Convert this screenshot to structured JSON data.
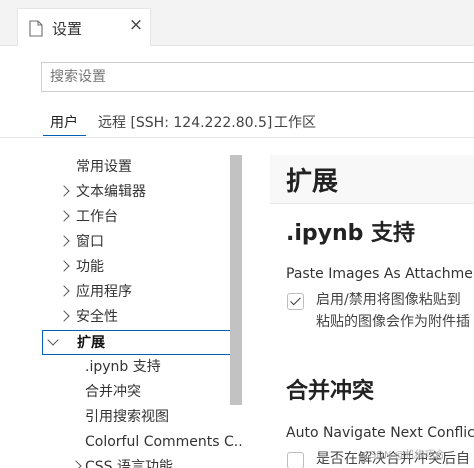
{
  "tab": {
    "title": "设置",
    "close_glyph": "×",
    "file_icon": "file-icon"
  },
  "search": {
    "placeholder": "搜索设置",
    "value": ""
  },
  "scopes": [
    {
      "label": "用户",
      "active": true
    },
    {
      "label": "远程 [SSH: 124.222.80.5]",
      "active": false
    },
    {
      "label": "工作区",
      "active": false
    }
  ],
  "tree": [
    {
      "label": "常用设置",
      "chevron": "none"
    },
    {
      "label": "文本编辑器",
      "chevron": "right"
    },
    {
      "label": "工作台",
      "chevron": "right"
    },
    {
      "label": "窗口",
      "chevron": "right"
    },
    {
      "label": "功能",
      "chevron": "right"
    },
    {
      "label": "应用程序",
      "chevron": "right"
    },
    {
      "label": "安全性",
      "chevron": "right"
    },
    {
      "label": "扩展",
      "chevron": "down",
      "selected": true
    },
    {
      "label": ".ipynb 支持",
      "child": true
    },
    {
      "label": "合并冲突",
      "child": true
    },
    {
      "label": "引用搜索视图",
      "child": true
    },
    {
      "label": "Colorful Comments C...",
      "child": true
    },
    {
      "label": "CSS 语言功能",
      "chevron": "right",
      "child": true
    }
  ],
  "content": {
    "header": "扩展",
    "sections": [
      {
        "title": ".ipynb 支持",
        "setting_title": "Paste Images As Attachment",
        "checked": true,
        "desc_line1": "启用/禁用将图像粘贴到",
        "desc_line2": "粘贴的图像会作为附件插"
      },
      {
        "title": "合并冲突",
        "setting_title": "Auto Navigate Next Conflict",
        "checked": false,
        "desc_line1": "是否在解决合并冲突后自"
      }
    ]
  },
  "watermark": "CSDN @机缘巧合"
}
